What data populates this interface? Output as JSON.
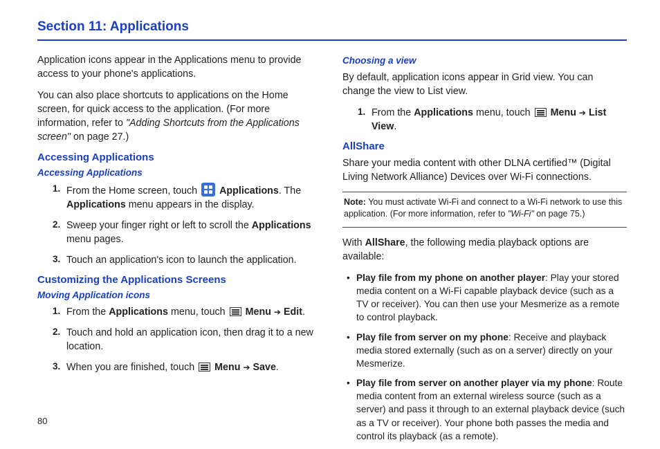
{
  "section_title": "Section 11: Applications",
  "page_number": "80",
  "left": {
    "intro1": "Application icons appear in the Applications menu to provide access to your phone's applications.",
    "intro2_a": "You can also place shortcuts to applications on the Home screen, for quick access to the application. (For more information, refer to ",
    "intro2_ref": "\"Adding Shortcuts from the Applications screen\"",
    "intro2_b": " on page 27.)",
    "h2a": "Accessing Applications",
    "h3a": "Accessing Applications",
    "step1_a": "From the Home screen, touch ",
    "step1_b": "Applications",
    "step1_c": ". The ",
    "step1_d": "Applications",
    "step1_e": " menu appears in the display.",
    "step2_a": "Sweep your finger right or left to scroll the ",
    "step2_b": "Applications",
    "step2_c": " menu pages.",
    "step3": "Touch an application's icon to launch the application.",
    "h2b": "Customizing the Applications Screens",
    "h3b": "Moving Application icons",
    "mstep1_a": "From the ",
    "mstep1_b": "Applications",
    "mstep1_c": " menu, touch ",
    "mstep1_d": "Menu",
    "mstep1_arrow": "➔",
    "mstep1_e": "Edit",
    "mstep1_f": ".",
    "mstep2": "Touch and hold an application icon, then drag it to a new location.",
    "mstep3_a": "When you are finished, touch ",
    "mstep3_b": "Menu",
    "mstep3_arrow": "➔",
    "mstep3_c": "Save",
    "mstep3_d": "."
  },
  "right": {
    "h3_cv": "Choosing a view",
    "cv_body": "By default, application icons appear in Grid view. You can change the view to List view.",
    "cv_step_a": "From the ",
    "cv_step_b": "Applications",
    "cv_step_c": " menu, touch ",
    "cv_step_d": "Menu",
    "cv_step_arrow": "➔",
    "cv_step_e": "List View",
    "cv_step_f": ".",
    "h2_all": "AllShare",
    "all_body": "Share your media content with other DLNA certified™ (Digital Living Network Alliance) Devices over Wi-Fi connections.",
    "note_label": "Note:",
    "note_a": " You must activate Wi-Fi and connect to a Wi-Fi network to use this application. (For more information, refer to ",
    "note_ref": "\"Wi-Fi\"",
    "note_b": " on page 75.)",
    "with_a": "With ",
    "with_b": "AllShare",
    "with_c": ", the following media playback options are available:",
    "b1_a": "Play file from my phone on another player",
    "b1_b": ": Play your stored media content on a Wi-Fi capable playback device (such as a TV or receiver). You can then use your Mesmerize as a remote to control playback.",
    "b2_a": "Play file from server on my phone",
    "b2_b": ": Receive and playback media stored externally (such as on a server) directly on your Mesmerize.",
    "b3_a": "Play file from server on another player via my phone",
    "b3_b": ": Route media content from an external wireless source (such as a server) and pass it through to an external playback device (such as a TV or receiver). Your phone both passes the media and control its playback (as a remote)."
  }
}
